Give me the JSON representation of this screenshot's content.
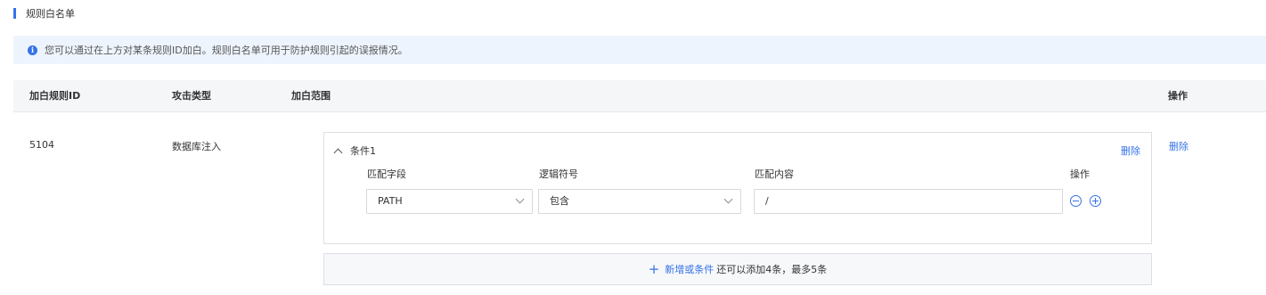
{
  "section": {
    "title": "规则白名单"
  },
  "info": {
    "icon": "info-icon",
    "text": "您可以通过在上方对某条规则ID加白。规则白名单可用于防护规则引起的误报情况。"
  },
  "table": {
    "headers": {
      "rule_id": "加白规则ID",
      "attack_type": "攻击类型",
      "scope": "加白范围",
      "action": "操作"
    },
    "row": {
      "rule_id": "5104",
      "attack_type": "数据库注入",
      "delete_label": "删除",
      "condition": {
        "title": "条件1",
        "delete_label": "删除",
        "columns": {
          "field": "匹配字段",
          "logic": "逻辑符号",
          "content": "匹配内容",
          "action": "操作"
        },
        "field_value": "PATH",
        "logic_value": "包含",
        "content_value": "/"
      },
      "add_condition": {
        "link": "新增或条件",
        "hint": "还可以添加4条，最多5条"
      }
    }
  },
  "colors": {
    "accent": "#3572e8",
    "banner_bg": "#eef4fd",
    "header_bg": "#f5f6f8"
  }
}
